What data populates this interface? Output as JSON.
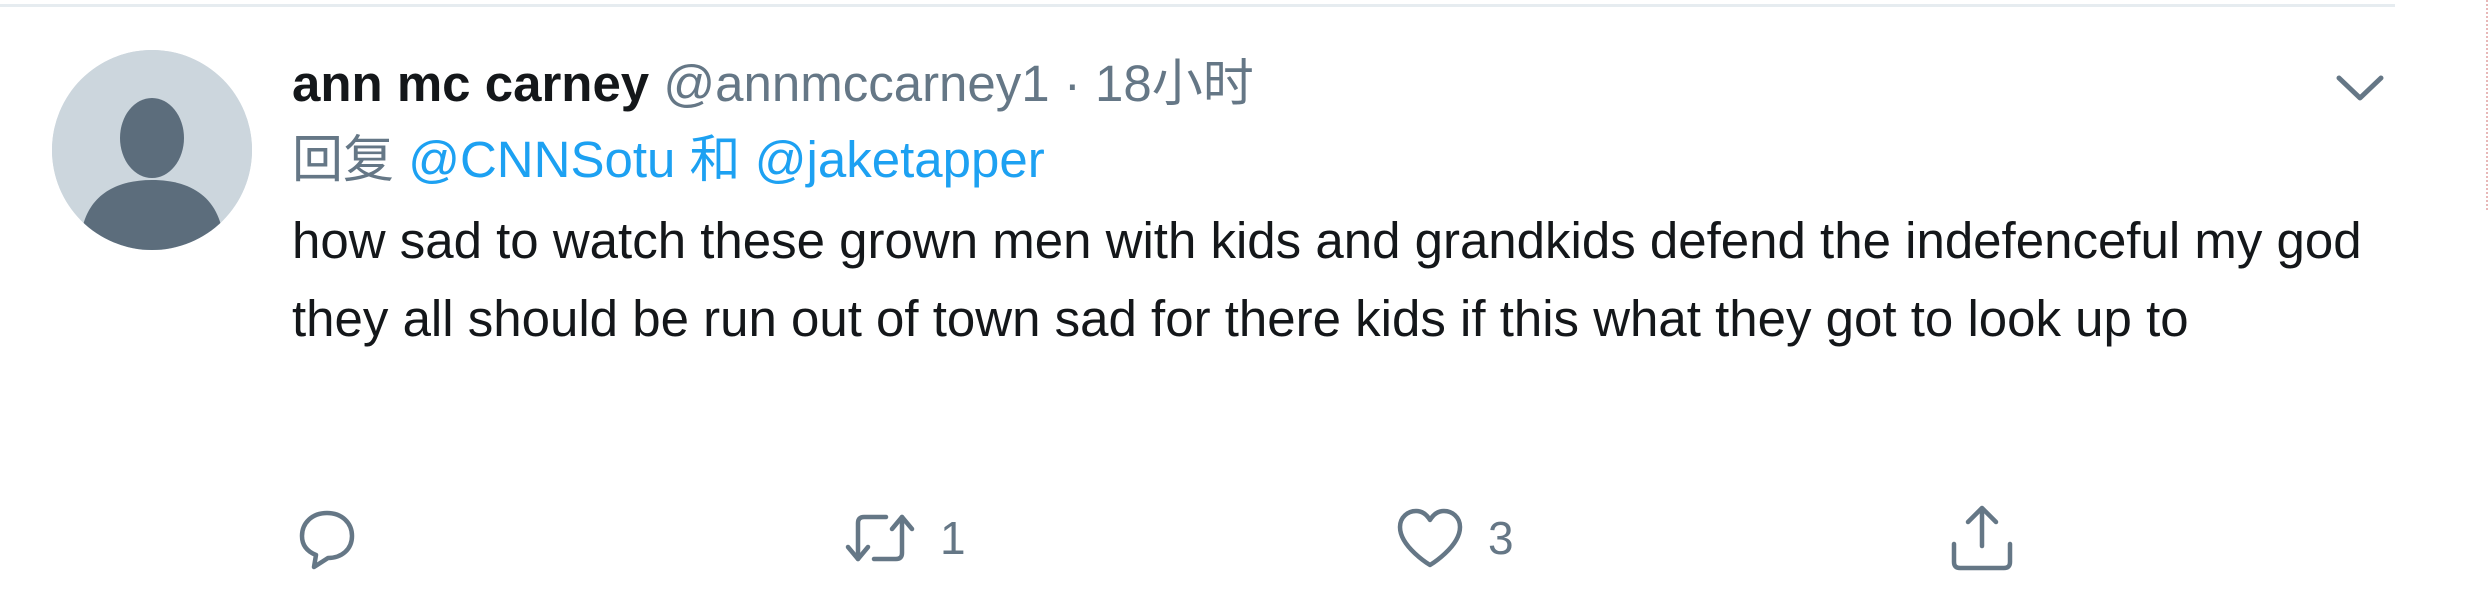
{
  "tweet": {
    "display_name": "ann mc carney",
    "handle": "@annmccarney1",
    "separator": "·",
    "time": "18小时",
    "reply_prefix": "回复",
    "reply_mention_1": "@CNNSotu",
    "reply_conjunction": "和",
    "reply_mention_2": "@jaketapper",
    "text": "how sad to watch these grown men with kids and grandkids defend the indefenceful my god they all should be run out of town sad for there kids if this what they got to look up to"
  },
  "actions": {
    "reply_count": "",
    "retweet_count": "1",
    "like_count": "3"
  },
  "icons": {
    "avatar": "default-avatar-icon",
    "caret": "chevron-down-icon",
    "reply": "comment-bubble-icon",
    "retweet": "retweet-icon",
    "like": "heart-icon",
    "share": "share-upload-icon"
  },
  "colors": {
    "primary_text": "#14171a",
    "secondary_text": "#657786",
    "link": "#1da1f2",
    "avatar_bg": "#ccd6dd",
    "avatar_fg": "#5c6d7c",
    "divider": "#e6ecf0"
  }
}
